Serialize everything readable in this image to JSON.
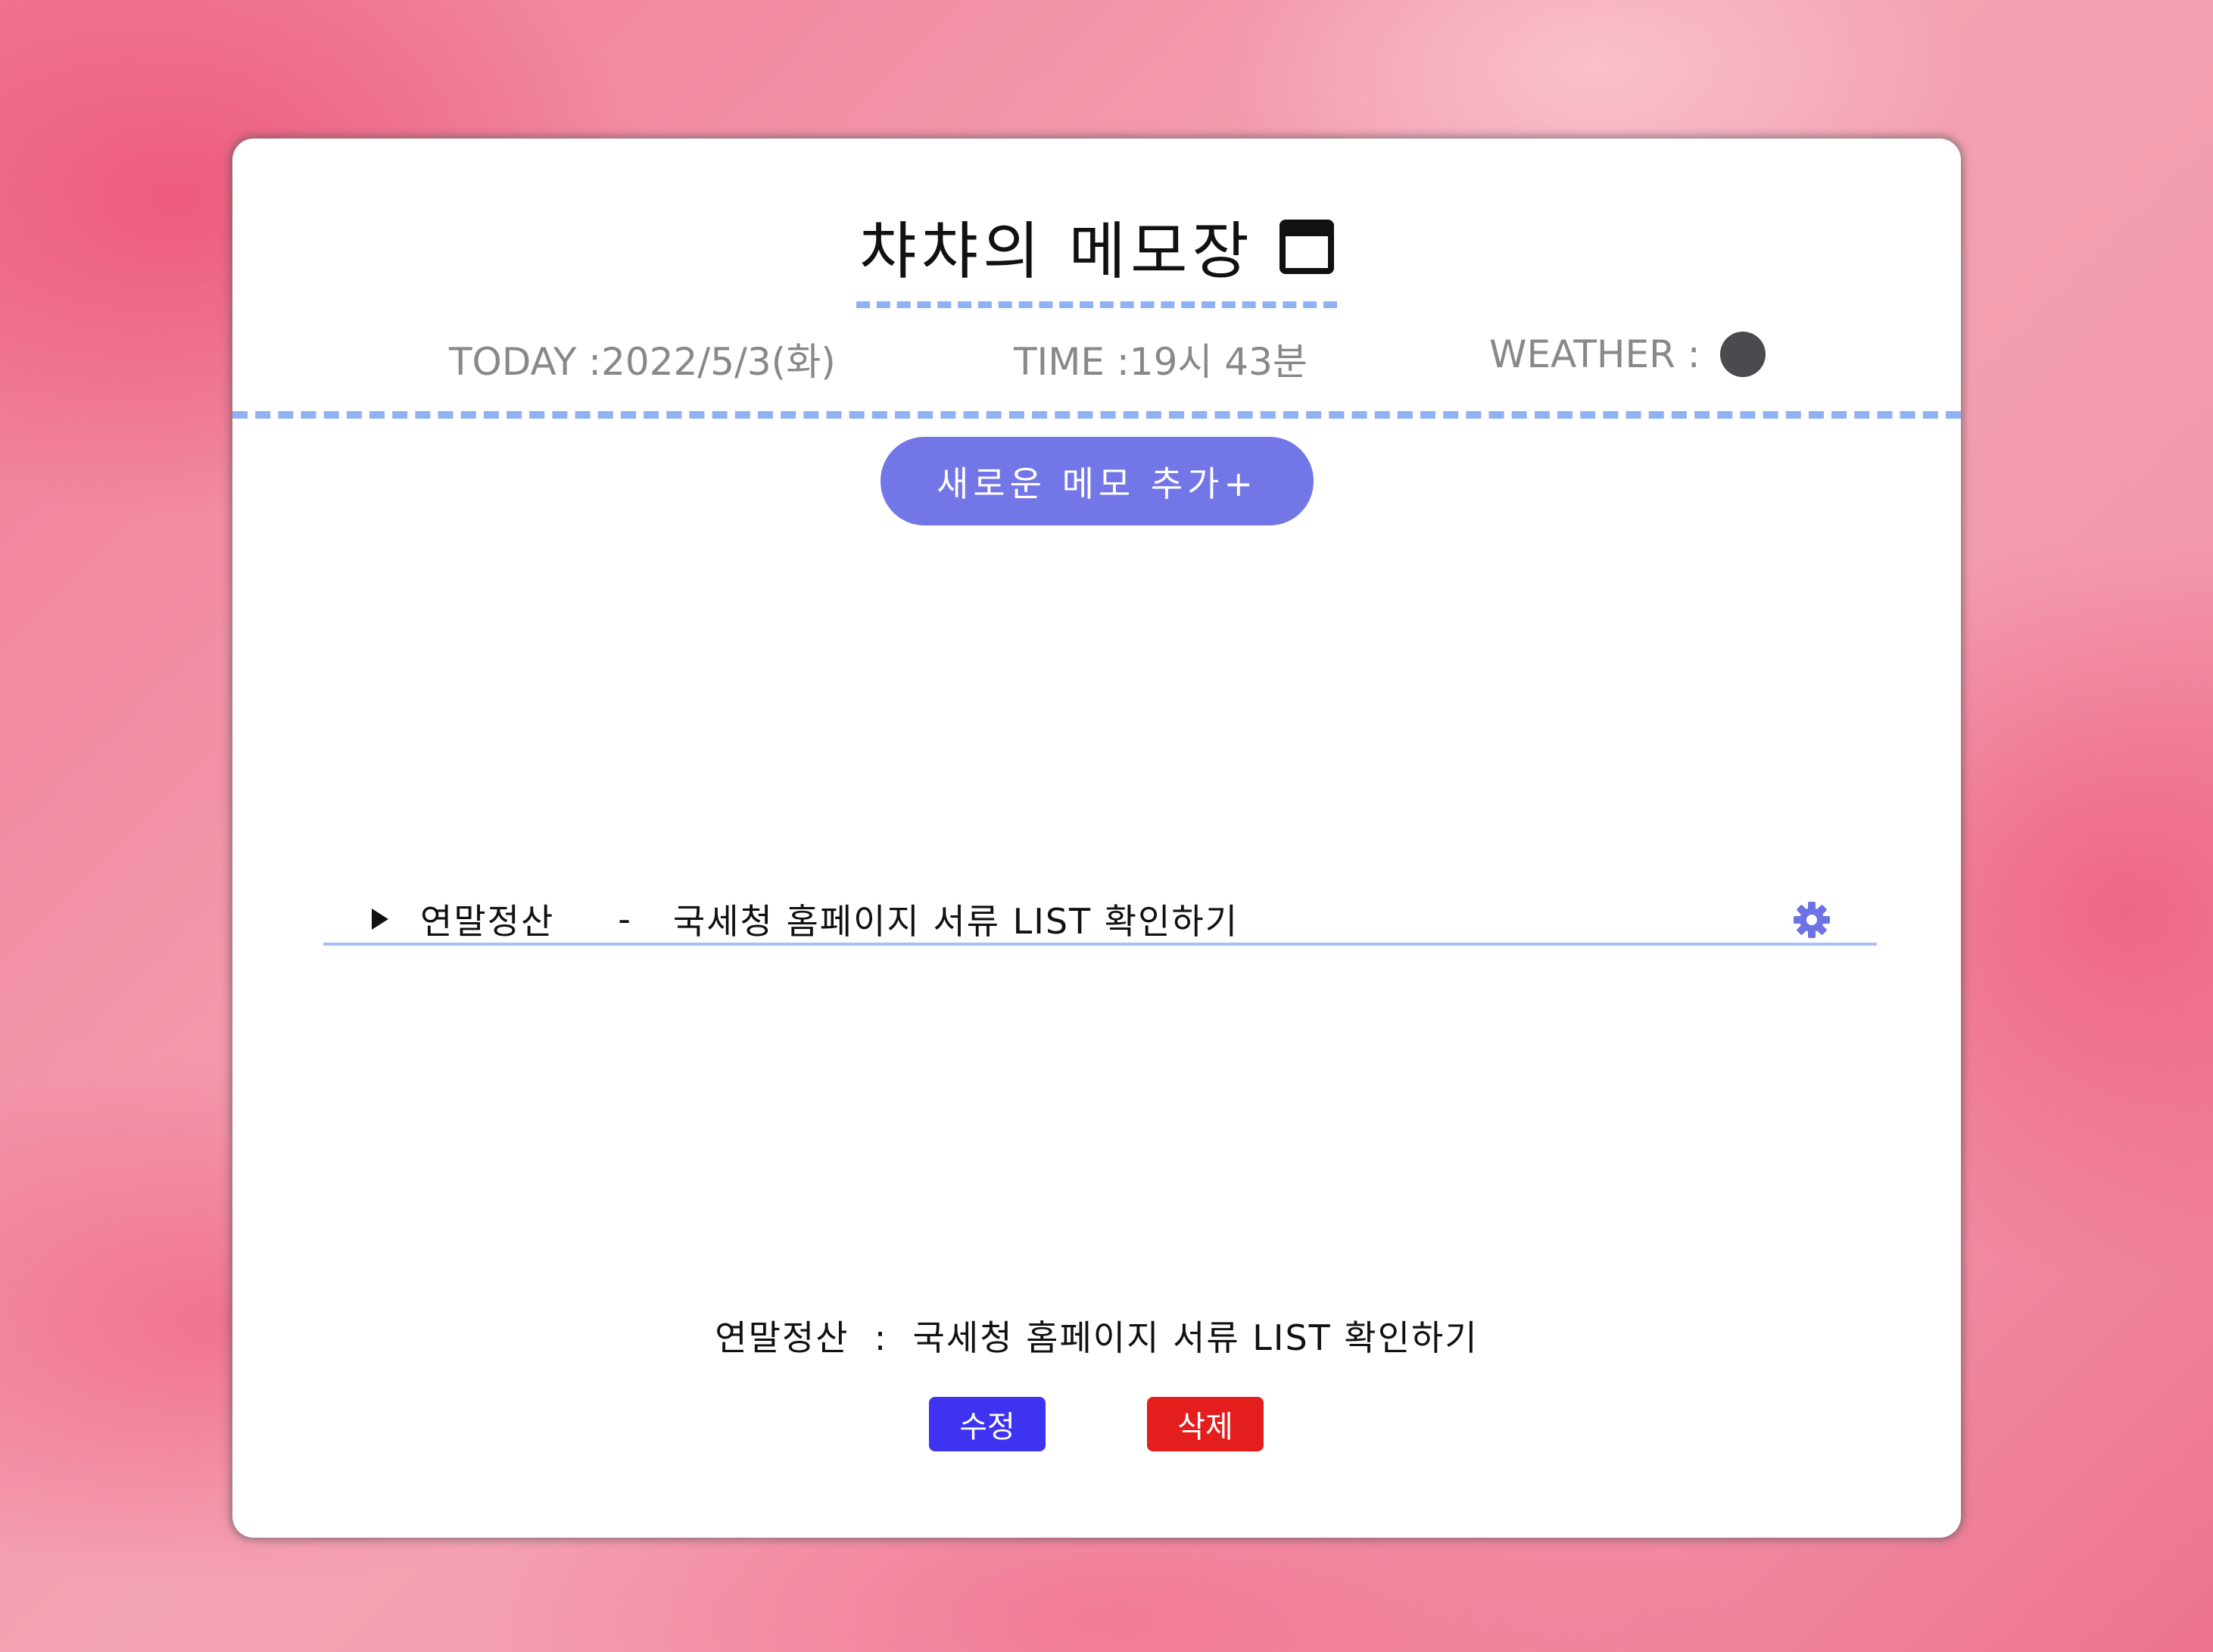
{
  "header": {
    "title": "챠챠의 메모장",
    "title_icon": "calendar-icon"
  },
  "info": {
    "today": "TODAY :2022/5/3(화)",
    "time": "TIME :19시 43분",
    "weather_label": "WEATHER :",
    "weather_icon": "weather-dot-icon"
  },
  "actions": {
    "add_memo_label": "새로운 메모 추가+"
  },
  "memo_list": [
    {
      "title": "연말정산",
      "separator": "-",
      "content": "국세청 홈페이지 서류 LIST 확인하기",
      "settings_icon": "gear-icon"
    }
  ],
  "memo_detail": {
    "text": "연말정산  :  국세청 홈페이지 서류 LIST 확인하기",
    "edit_label": "수정",
    "delete_label": "삭제"
  },
  "colors": {
    "accent": "#7376e6",
    "dashed_line": "#8fb2f5",
    "edit_button": "#3d33f0",
    "delete_button": "#e41d1d",
    "weather_dot": "#4a4a4f",
    "background": "#f39aae"
  }
}
